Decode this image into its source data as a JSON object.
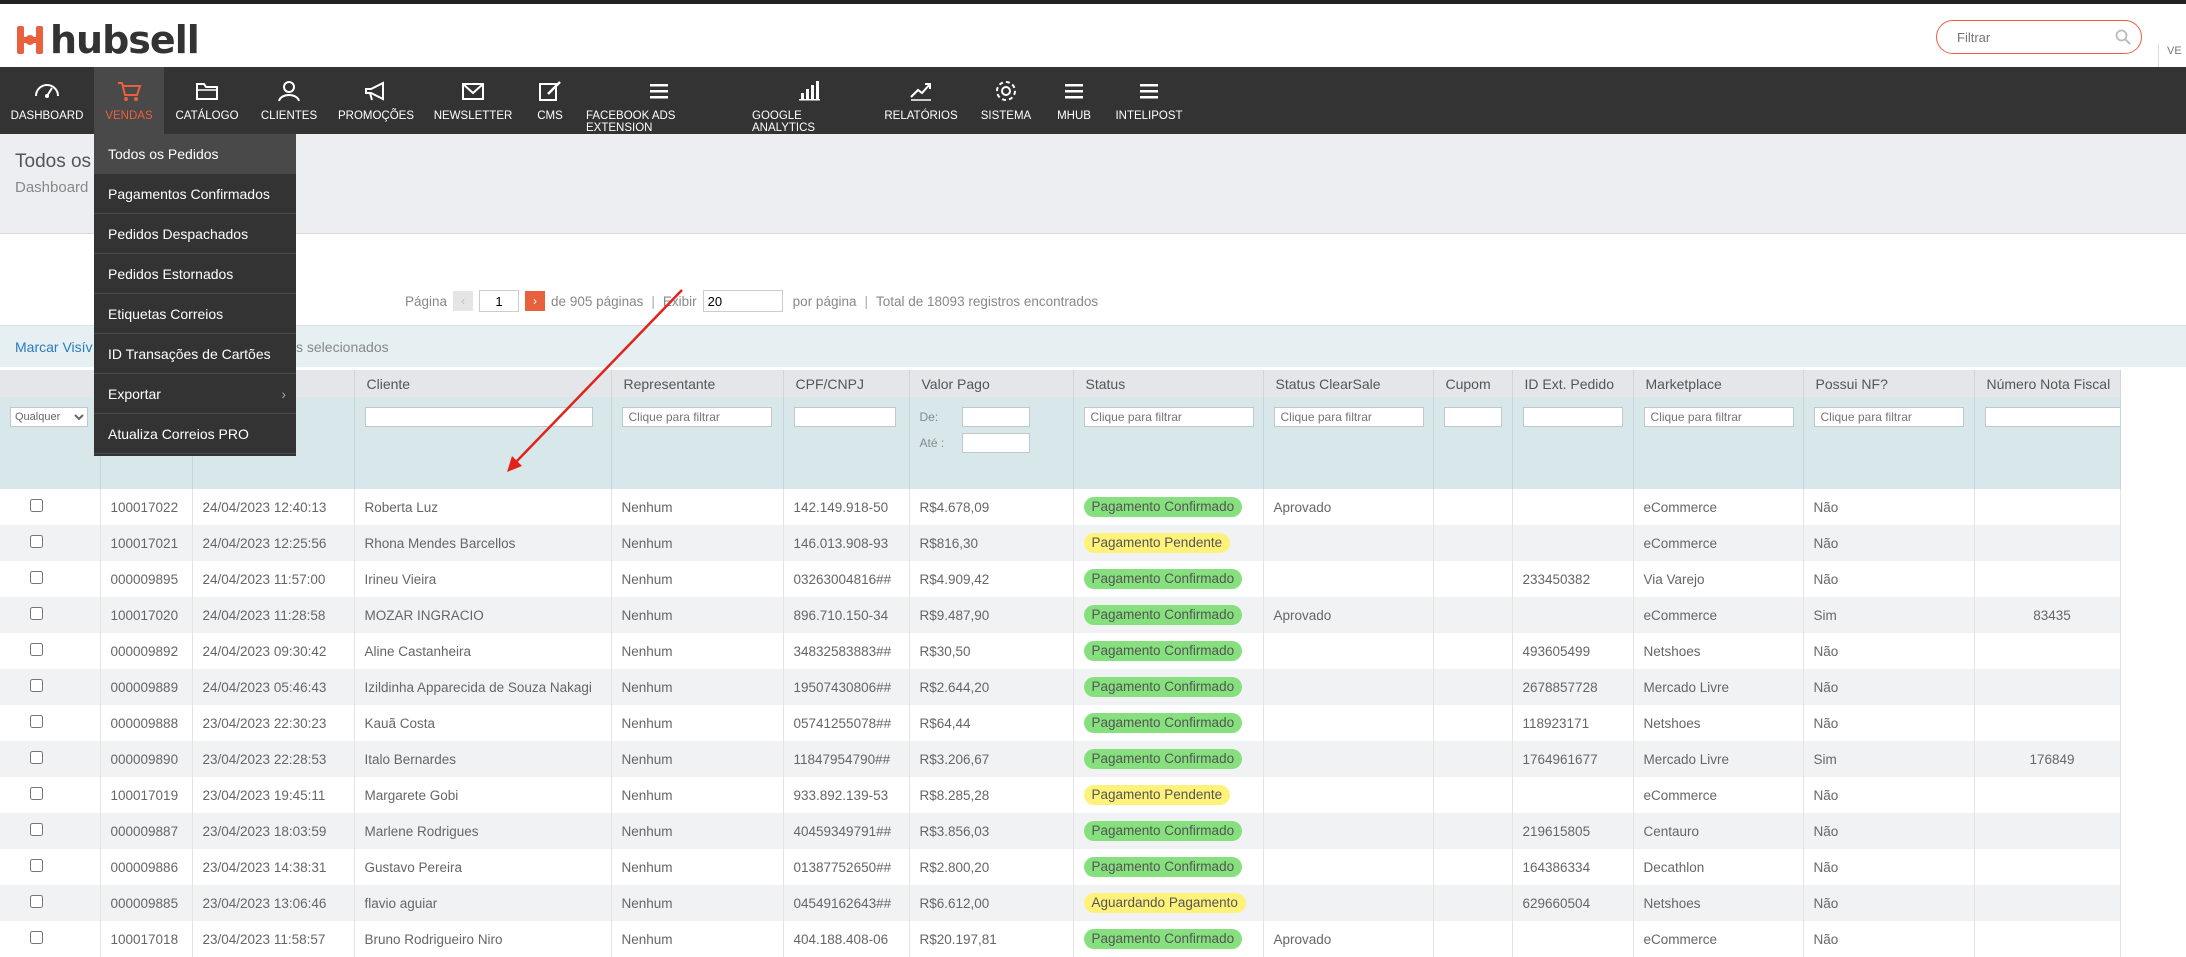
{
  "brand": {
    "logo_text": "hubsell",
    "accent": "#e8603c"
  },
  "search": {
    "placeholder": "Filtrar"
  },
  "top_right_label": "VE",
  "nav": [
    {
      "label": "DASHBOARD",
      "icon": "speedometer-icon"
    },
    {
      "label": "VENDAS",
      "icon": "cart-icon",
      "active": true
    },
    {
      "label": "CATÁLOGO",
      "icon": "folder-icon"
    },
    {
      "label": "CLIENTES",
      "icon": "user-icon"
    },
    {
      "label": "PROMOÇÕES",
      "icon": "megaphone-icon"
    },
    {
      "label": "NEWSLETTER",
      "icon": "envelope-icon"
    },
    {
      "label": "CMS",
      "icon": "edit-icon"
    },
    {
      "label": "FACEBOOK ADS EXTENSION",
      "icon": "menu-icon"
    },
    {
      "label": "GOOGLE ANALYTICS",
      "icon": "bar-chart-icon"
    },
    {
      "label": "RELATÓRIOS",
      "icon": "trend-line-icon"
    },
    {
      "label": "SISTEMA",
      "icon": "gear-icon"
    },
    {
      "label": "MHUB",
      "icon": "menu-icon"
    },
    {
      "label": "INTELIPOST",
      "icon": "menu-icon"
    }
  ],
  "dropdown": [
    {
      "label": "Todos os Pedidos",
      "active": true
    },
    {
      "label": "Pagamentos Confirmados"
    },
    {
      "label": "Pedidos Despachados"
    },
    {
      "label": "Pedidos Estornados"
    },
    {
      "label": "Etiquetas Correios"
    },
    {
      "label": "ID Transações de Cartões"
    },
    {
      "label": "Exportar",
      "submenu": true
    },
    {
      "label": "Atualiza Correios PRO"
    }
  ],
  "page": {
    "title": "Todos os",
    "breadcrumb": "Dashboard"
  },
  "pager": {
    "page_label": "Página",
    "page_value": "1",
    "of_pages": "de 905 páginas",
    "show_label": "Exibir",
    "per_page_value": "20",
    "per_page_label": "por página",
    "total": "Total de 18093 registros encontrados"
  },
  "massaction": {
    "mark_visible": "Marcar Visív",
    "selected_text": "s selecionados"
  },
  "table": {
    "headers": [
      "",
      "",
      "",
      "Cliente",
      "Representante",
      "CPF/CNPJ",
      "Valor Pago",
      "Status",
      "Status ClearSale",
      "Cupom",
      "ID Ext. Pedido",
      "Marketplace",
      "Possui NF?",
      "Número Nota Fiscal"
    ],
    "filters": {
      "any_option": "Qualquer",
      "filter_placeholder": "Clique para filtrar",
      "from_label": "De:",
      "to_label": "Até :"
    },
    "rows": [
      {
        "id": "100017022",
        "date": "24/04/2023 12:40:13",
        "client": "Roberta Luz",
        "rep": "Nenhum",
        "doc": "142.149.918-50",
        "value": "R$4.678,09",
        "status": "Pagamento Confirmado",
        "status_color": "#86e07e",
        "clearsale": "Aprovado",
        "coupon": "",
        "ext_id": "",
        "marketplace": "eCommerce",
        "has_nf": "Não",
        "nf_number": ""
      },
      {
        "id": "100017021",
        "date": "24/04/2023 12:25:56",
        "client": "Rhona Mendes Barcellos",
        "rep": "Nenhum",
        "doc": "146.013.908-93",
        "value": "R$816,30",
        "status": "Pagamento Pendente",
        "status_color": "#fff27a",
        "clearsale": "",
        "coupon": "",
        "ext_id": "",
        "marketplace": "eCommerce",
        "has_nf": "Não",
        "nf_number": ""
      },
      {
        "id": "000009895",
        "date": "24/04/2023 11:57:00",
        "client": "Irineu Vieira",
        "rep": "Nenhum",
        "doc": "03263004816##",
        "value": "R$4.909,42",
        "status": "Pagamento Confirmado",
        "status_color": "#86e07e",
        "clearsale": "",
        "coupon": "",
        "ext_id": "233450382",
        "marketplace": "Via Varejo",
        "has_nf": "Não",
        "nf_number": ""
      },
      {
        "id": "100017020",
        "date": "24/04/2023 11:28:58",
        "client": "MOZAR INGRACIO",
        "rep": "Nenhum",
        "doc": "896.710.150-34",
        "value": "R$9.487,90",
        "status": "Pagamento Confirmado",
        "status_color": "#86e07e",
        "clearsale": "Aprovado",
        "coupon": "",
        "ext_id": "",
        "marketplace": "eCommerce",
        "has_nf": "Sim",
        "nf_number": "83435"
      },
      {
        "id": "000009892",
        "date": "24/04/2023 09:30:42",
        "client": "Aline Castanheira",
        "rep": "Nenhum",
        "doc": "34832583883##",
        "value": "R$30,50",
        "status": "Pagamento Confirmado",
        "status_color": "#86e07e",
        "clearsale": "",
        "coupon": "",
        "ext_id": "493605499",
        "marketplace": "Netshoes",
        "has_nf": "Não",
        "nf_number": ""
      },
      {
        "id": "000009889",
        "date": "24/04/2023 05:46:43",
        "client": "Izildinha Apparecida de Souza Nakagi",
        "rep": "Nenhum",
        "doc": "19507430806##",
        "value": "R$2.644,20",
        "status": "Pagamento Confirmado",
        "status_color": "#86e07e",
        "clearsale": "",
        "coupon": "",
        "ext_id": "2678857728",
        "marketplace": "Mercado Livre",
        "has_nf": "Não",
        "nf_number": ""
      },
      {
        "id": "000009888",
        "date": "23/04/2023 22:30:23",
        "client": "Kauã Costa",
        "rep": "Nenhum",
        "doc": "05741255078##",
        "value": "R$64,44",
        "status": "Pagamento Confirmado",
        "status_color": "#86e07e",
        "clearsale": "",
        "coupon": "",
        "ext_id": "118923171",
        "marketplace": "Netshoes",
        "has_nf": "Não",
        "nf_number": ""
      },
      {
        "id": "000009890",
        "date": "23/04/2023 22:28:53",
        "client": "Italo Bernardes",
        "rep": "Nenhum",
        "doc": "11847954790##",
        "value": "R$3.206,67",
        "status": "Pagamento Confirmado",
        "status_color": "#86e07e",
        "clearsale": "",
        "coupon": "",
        "ext_id": "1764961677",
        "marketplace": "Mercado Livre",
        "has_nf": "Sim",
        "nf_number": "176849"
      },
      {
        "id": "100017019",
        "date": "23/04/2023 19:45:11",
        "client": "Margarete Gobi",
        "rep": "Nenhum",
        "doc": "933.892.139-53",
        "value": "R$8.285,28",
        "status": "Pagamento Pendente",
        "status_color": "#fff27a",
        "clearsale": "",
        "coupon": "",
        "ext_id": "",
        "marketplace": "eCommerce",
        "has_nf": "Não",
        "nf_number": ""
      },
      {
        "id": "000009887",
        "date": "23/04/2023 18:03:59",
        "client": "Marlene Rodrigues",
        "rep": "Nenhum",
        "doc": "40459349791##",
        "value": "R$3.856,03",
        "status": "Pagamento Confirmado",
        "status_color": "#86e07e",
        "clearsale": "",
        "coupon": "",
        "ext_id": "219615805",
        "marketplace": "Centauro",
        "has_nf": "Não",
        "nf_number": ""
      },
      {
        "id": "000009886",
        "date": "23/04/2023 14:38:31",
        "client": "Gustavo Pereira",
        "rep": "Nenhum",
        "doc": "01387752650##",
        "value": "R$2.800,20",
        "status": "Pagamento Confirmado",
        "status_color": "#86e07e",
        "clearsale": "",
        "coupon": "",
        "ext_id": "164386334",
        "marketplace": "Decathlon",
        "has_nf": "Não",
        "nf_number": ""
      },
      {
        "id": "000009885",
        "date": "23/04/2023 13:06:46",
        "client": "flavio aguiar",
        "rep": "Nenhum",
        "doc": "04549162643##",
        "value": "R$6.612,00",
        "status": "Aguardando Pagamento",
        "status_color": "#fff27a",
        "clearsale": "",
        "coupon": "",
        "ext_id": "629660504",
        "marketplace": "Netshoes",
        "has_nf": "Não",
        "nf_number": ""
      },
      {
        "id": "100017018",
        "date": "23/04/2023 11:58:57",
        "client": "Bruno Rodrigueiro Niro",
        "rep": "Nenhum",
        "doc": "404.188.408-06",
        "value": "R$20.197,81",
        "status": "Pagamento Confirmado",
        "status_color": "#86e07e",
        "clearsale": "Aprovado",
        "coupon": "",
        "ext_id": "",
        "marketplace": "eCommerce",
        "has_nf": "Não",
        "nf_number": ""
      }
    ]
  }
}
